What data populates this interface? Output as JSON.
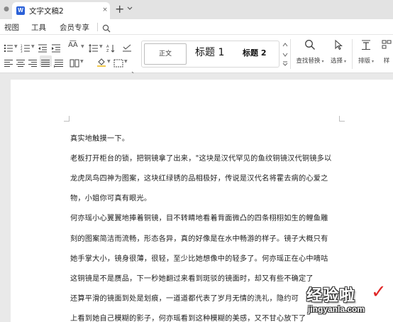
{
  "tabbar": {
    "home_icon": "dot-icon",
    "tab": {
      "icon": "W",
      "title": "文字文稿2",
      "close": "×"
    },
    "add": "+",
    "more": "⌄"
  },
  "menu": {
    "items": [
      "视图",
      "工具",
      "会员专享"
    ],
    "search_icon": "search-icon"
  },
  "ribbon": {
    "styles": {
      "normal": "正文",
      "h1": "标题 1",
      "h2": "标题 2"
    },
    "find_replace": "查找替换",
    "select": "选择",
    "layout": "排版",
    "style_pane": "样"
  },
  "document": {
    "paragraphs": [
      "真实地触摸一下。",
      "老板打开柜台的锁，把铜镜拿了出来，\"这块是汉代罕见的鱼纹铜镜汉代铜镜多以",
      "龙虎凤鸟四神为图案，这块红绿锈的品相极好，传说是汉代名将霍去病的心爱之",
      "物，小姐你可真有眼光。",
      "何亦瑶小心翼翼地捧着铜镜，目不转睛地看着背面微凸的四条栩栩如生的鲤鱼雕",
      "刻的图案简洁而流畅，形态各异，真的好像是在水中畅游的样子。镜子大概只有",
      "她手掌大小，镜身很薄，很轻，至少比她想像中的轻多了。何亦瑶正在心中嘀咕",
      "这铜镜是不是赝品，下一秒她翻过来看到斑驳的镜面时，却又有些不确定了",
      "还算平滑的镜面到处是划痕，一道道都代表了岁月无情的洗礼，隐约可",
      "上看到她自己模糊的影子，何亦瑶看到这种模糊的美感，又不甘心放下了"
    ]
  },
  "watermark": {
    "main": "经验啦",
    "check": "✓",
    "url": "jingyanla.com"
  },
  "colors": {
    "accent": "#2b61d8",
    "tabbar_bg": "#e3e3e3",
    "doc_bg": "#e9e9e9",
    "check": "#e02828"
  }
}
